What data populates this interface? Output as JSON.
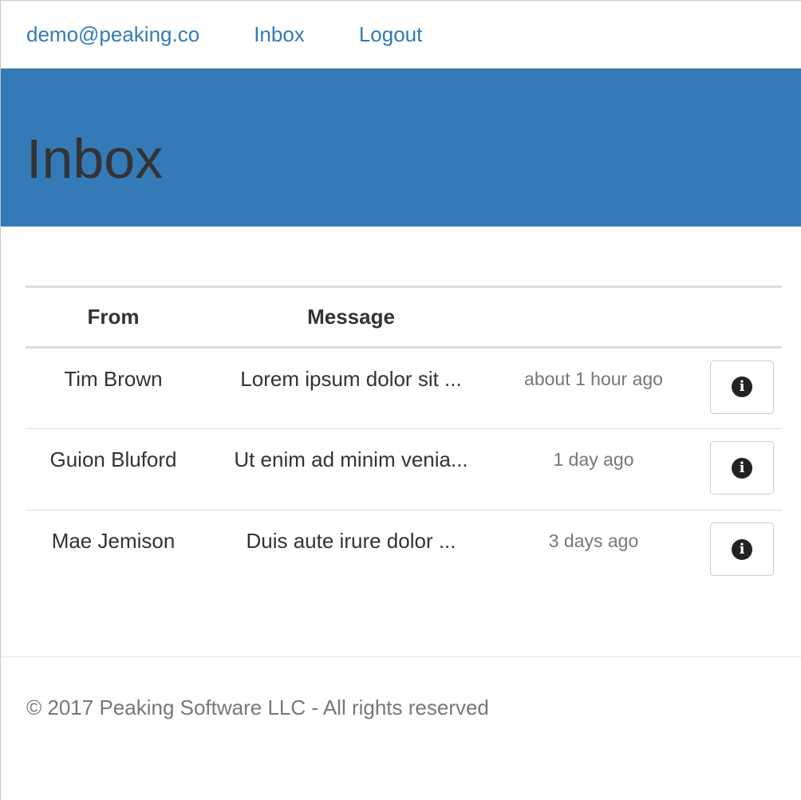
{
  "navbar": {
    "email": "demo@peaking.co",
    "inbox_link": "Inbox",
    "logout_link": "Logout"
  },
  "hero": {
    "title": "Inbox"
  },
  "table": {
    "headers": {
      "from": "From",
      "message": "Message",
      "time": "",
      "action": ""
    },
    "rows": [
      {
        "from": "Tim Brown",
        "message": "Lorem ipsum dolor sit ...",
        "time": "about 1 hour ago",
        "action_icon": "info-icon"
      },
      {
        "from": "Guion Bluford",
        "message": "Ut enim ad minim venia...",
        "time": "1 day ago",
        "action_icon": "info-icon"
      },
      {
        "from": "Mae Jemison",
        "message": "Duis aute irure dolor ...",
        "time": "3 days ago",
        "action_icon": "info-icon"
      }
    ]
  },
  "footer": {
    "copyright": "© 2017 Peaking Software LLC - All rights reserved"
  },
  "colors": {
    "brand": "#337ab7",
    "link": "#337ab7",
    "muted": "#777777",
    "text": "#333333"
  }
}
